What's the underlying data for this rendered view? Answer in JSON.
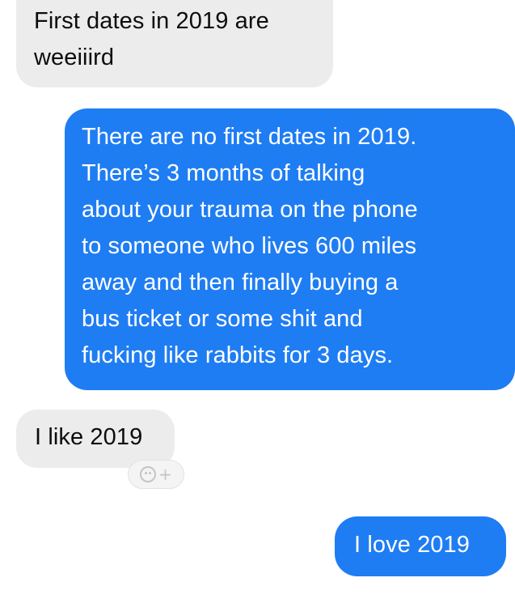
{
  "conversation": {
    "messages": [
      {
        "direction": "received",
        "text": "First dates in 2019 are\nweeiiird"
      },
      {
        "direction": "sent",
        "text": "There are no first dates in 2019.\nThere’s 3 months of talking\nabout your trauma on the phone\nto someone who lives 600 miles\naway and then finally buying a\nbus ticket or some shit and\nfucking like rabbits for 3 days."
      },
      {
        "direction": "received",
        "text": "I like 2019"
      },
      {
        "direction": "sent",
        "text": "I love 2019"
      }
    ],
    "reaction_button": {
      "icon": "smiley-add-icon",
      "plus": "+"
    }
  },
  "colors": {
    "sent_bubble": "#1f7df3",
    "received_bubble": "#ececec",
    "sent_text": "#ffffff",
    "received_text": "#0d0d0d"
  }
}
